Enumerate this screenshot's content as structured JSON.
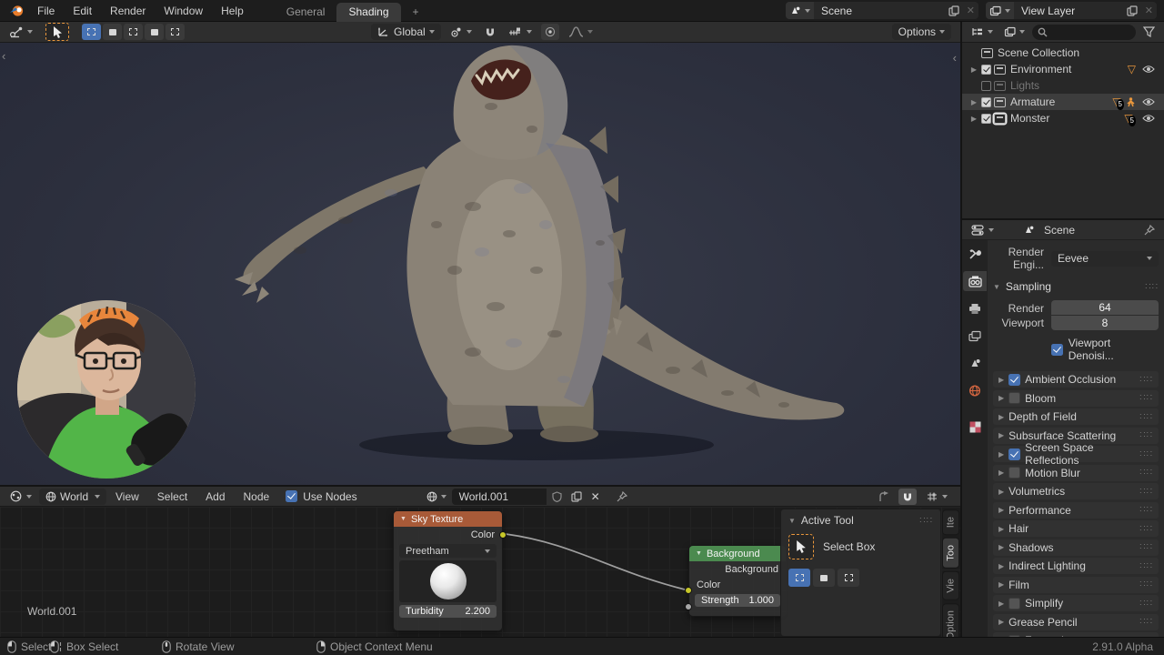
{
  "topbar": {
    "menus": [
      "File",
      "Edit",
      "Render",
      "Window",
      "Help"
    ],
    "tabs": [
      {
        "label": "General"
      },
      {
        "label": "Shading"
      }
    ],
    "new_tab": "+",
    "scene": {
      "value": "Scene"
    },
    "view_layer": {
      "value": "View Layer"
    }
  },
  "viewport_header": {
    "orientation": "Global",
    "options_label": "Options"
  },
  "outliner": {
    "root": "Scene Collection",
    "rows": [
      {
        "label": "Environment",
        "state": "checked",
        "count": "",
        "eye": true
      },
      {
        "label": "Lights",
        "state": "unchecked",
        "count": ""
      },
      {
        "label": "Armature",
        "state": "checked",
        "count": "5",
        "eye": true
      },
      {
        "label": "Monster",
        "state": "checked",
        "count": "5",
        "eye": true
      }
    ]
  },
  "properties": {
    "breadcrumb": "Scene",
    "render_engine_label": "Render Engi...",
    "render_engine_value": "Eevee",
    "sampling": {
      "title": "Sampling",
      "render_label": "Render",
      "render_value": "64",
      "viewport_label": "Viewport",
      "viewport_value": "8",
      "denoise_label": "Viewport Denoisi...",
      "denoise_state": "checked"
    },
    "panels": [
      {
        "label": "Ambient Occlusion",
        "checkbox": "checked"
      },
      {
        "label": "Bloom",
        "checkbox": "unchecked"
      },
      {
        "label": "Depth of Field",
        "checkbox": "none"
      },
      {
        "label": "Subsurface Scattering",
        "checkbox": "none"
      },
      {
        "label": "Screen Space Reflections",
        "checkbox": "checked"
      },
      {
        "label": "Motion Blur",
        "checkbox": "unchecked"
      },
      {
        "label": "Volumetrics",
        "checkbox": "none"
      },
      {
        "label": "Performance",
        "checkbox": "none"
      },
      {
        "label": "Hair",
        "checkbox": "none"
      },
      {
        "label": "Shadows",
        "checkbox": "none"
      },
      {
        "label": "Indirect Lighting",
        "checkbox": "none"
      },
      {
        "label": "Film",
        "checkbox": "none"
      },
      {
        "label": "Simplify",
        "checkbox": "unchecked"
      },
      {
        "label": "Grease Pencil",
        "checkbox": "none"
      },
      {
        "label": "Freestyle",
        "checkbox": "unchecked"
      }
    ]
  },
  "shader_editor": {
    "shader_type": "World",
    "menus": [
      "View",
      "Select",
      "Add",
      "Node"
    ],
    "use_nodes_label": "Use Nodes",
    "use_nodes_state": "checked",
    "id_name": "World.001",
    "canvas_label": "World.001",
    "sky_node": {
      "title": "Sky Texture",
      "output_label": "Color",
      "sky_type": "Preetham",
      "turbidity_label": "Turbidity",
      "turbidity_value": "2.200"
    },
    "background_node": {
      "title": "Background",
      "output_label": "Background",
      "color_label": "Color",
      "strength_label": "Strength",
      "strength_value": "1.000"
    },
    "active_tool": {
      "title": "Active Tool",
      "tool_name": "Select Box"
    },
    "side_tabs": [
      "Ite",
      "Too",
      "Vie",
      "Option"
    ]
  },
  "status_bar": {
    "items": [
      "Select",
      "Box Select",
      "Rotate View",
      "Object Context Menu"
    ],
    "version": "2.91.0 Alpha"
  },
  "colors": {
    "accent_orange": "#e9973c",
    "selection_blue": "#4772b3",
    "sky_node_header": "#a85a38",
    "background_node_header": "#4b8a4f",
    "socket_yellow": "#c7c729"
  }
}
